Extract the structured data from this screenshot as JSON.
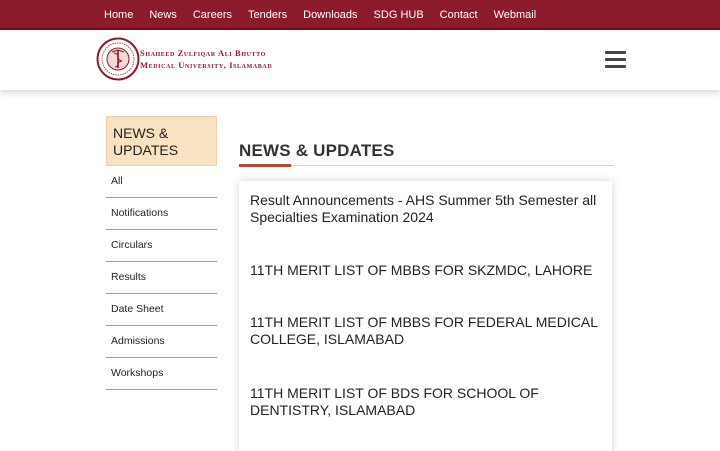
{
  "topnav": {
    "items": [
      "Home",
      "News",
      "Careers",
      "Tenders",
      "Downloads",
      "SDG HUB",
      "Contact",
      "Webmail"
    ]
  },
  "header": {
    "logo_line1": "Shaheed Zulfiqar Ali Bhutto",
    "logo_line2": "Medical University, Islamabad",
    "menu_icon": "hamburger-menu-icon"
  },
  "sidebar": {
    "title": "NEWS & UPDATES",
    "items": [
      "All",
      "Notifications",
      "Circulars",
      "Results",
      "Date Sheet",
      "Admissions",
      "Workshops"
    ]
  },
  "main": {
    "title": "NEWS & UPDATES",
    "news": [
      "Result Announcements - AHS Summer 5th Semester all Specialties Examination 2024",
      "11TH MERIT LIST OF MBBS FOR SKZMDC, LAHORE",
      "11TH MERIT LIST OF MBBS FOR FEDERAL MEDICAL COLLEGE, ISLAMABAD",
      "11TH MERIT LIST OF BDS FOR SCHOOL OF DENTISTRY, ISLAMABAD"
    ]
  },
  "colors": {
    "brand": "#8b1a2b",
    "sidebar_title_bg": "#f9e2c1",
    "accent_underline": "#b24a3a"
  }
}
